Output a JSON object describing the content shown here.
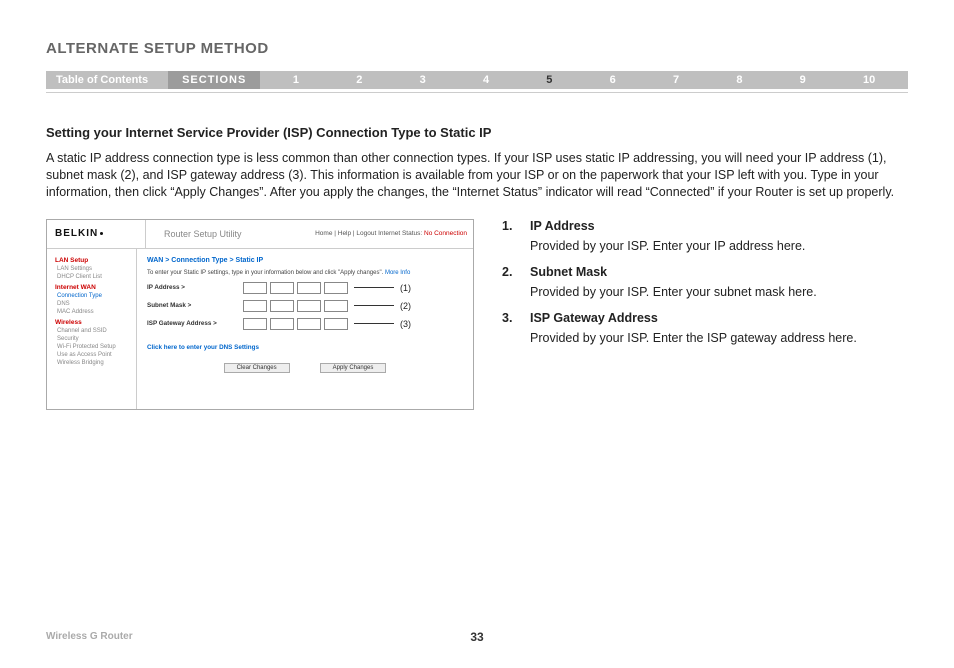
{
  "page_title": "ALTERNATE SETUP METHOD",
  "nav": {
    "toc": "Table of Contents",
    "sections_label": "SECTIONS",
    "numbers": [
      "1",
      "2",
      "3",
      "4",
      "5",
      "6",
      "7",
      "8",
      "9",
      "10"
    ],
    "active": "5"
  },
  "section_heading": "Setting your Internet Service Provider (ISP) Connection Type to Static IP",
  "body_text": "A static IP address connection type is less common than other connection types. If your ISP uses static IP addressing, you will need your IP address (1), subnet mask (2), and ISP gateway address (3). This information is available from your ISP or on the paperwork that your ISP left with you. Type in your information, then click “Apply Changes”. After you apply the changes, the “Internet Status” indicator will read “Connected” if your Router is set up properly.",
  "items": [
    {
      "num": "1.",
      "title": "IP Address",
      "desc": "Provided by your ISP. Enter your IP address here."
    },
    {
      "num": "2.",
      "title": "Subnet Mask",
      "desc": "Provided by your ISP. Enter your subnet mask here."
    },
    {
      "num": "3.",
      "title": "ISP Gateway Address",
      "desc": "Provided by your ISP. Enter the ISP gateway address here."
    }
  ],
  "router": {
    "brand": "BELKIN",
    "title": "Router Setup Utility",
    "links": "Home | Help | Logout   Internet Status:",
    "status": "No Connection",
    "sidebar": {
      "lan_setup": "LAN Setup",
      "lan_settings": "LAN Settings",
      "dhcp_client_list": "DHCP Client List",
      "internet_wan": "Internet WAN",
      "connection_type": "Connection Type",
      "dns": "DNS",
      "mac_address": "MAC Address",
      "wireless": "Wireless",
      "channel_ssid": "Channel and SSID",
      "security": "Security",
      "wps": "Wi-Fi Protected Setup",
      "use_ap": "Use as Access Point",
      "bridging": "Wireless Bridging"
    },
    "crumb": "WAN > Connection Type > Static IP",
    "instruct": "To enter your Static IP settings, type in your information below and click \"Apply changes\".",
    "more_info": "More Info",
    "fields": {
      "ip": "IP Address >",
      "subnet": "Subnet Mask >",
      "gateway": "ISP Gateway Address >"
    },
    "callouts": {
      "c1": "(1)",
      "c2": "(2)",
      "c3": "(3)"
    },
    "dns_link": "Click here to enter your DNS Settings",
    "buttons": {
      "clear": "Clear Changes",
      "apply": "Apply Changes"
    }
  },
  "footer": {
    "product": "Wireless G Router",
    "page": "33"
  }
}
